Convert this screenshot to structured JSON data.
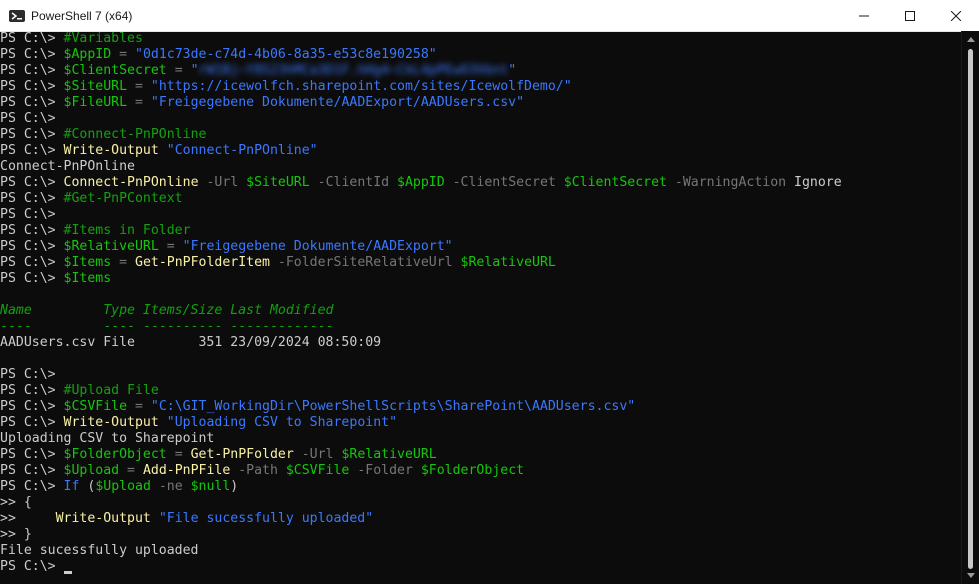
{
  "window": {
    "title": "PowerShell 7 (x64)",
    "minimize_label": "minimize",
    "maximize_label": "maximize",
    "close_label": "close"
  },
  "colors": {
    "default": "#cccccc",
    "comment": "#13a10e",
    "variable": "#16c60c",
    "string": "#3b78ff",
    "command": "#f9f1a5",
    "param": "#767676",
    "header": "#13a10e",
    "operator": "#767676",
    "keyword": "#3b78ff",
    "brace": "#cccccc"
  },
  "lines": [
    [
      {
        "t": "PS C:\\> ",
        "c": "default"
      },
      {
        "t": "#Variables",
        "c": "comment"
      }
    ],
    [
      {
        "t": "PS C:\\> ",
        "c": "default"
      },
      {
        "t": "$AppID",
        "c": "variable"
      },
      {
        "t": " = ",
        "c": "operator"
      },
      {
        "t": "\"0d1c73de-c74d-4b06-8a35-e53c8e190258\"",
        "c": "string"
      }
    ],
    [
      {
        "t": "PS C:\\> ",
        "c": "default"
      },
      {
        "t": "$ClientSecret",
        "c": "variable"
      },
      {
        "t": " = ",
        "c": "operator"
      },
      {
        "t": "\"",
        "c": "string"
      },
      {
        "t": "rW1Bj~Y8S23hMCa3D1F.hHg4~CkL4pPEwO3Vbnt",
        "c": "string",
        "blur": true
      },
      {
        "t": "\"",
        "c": "string"
      }
    ],
    [
      {
        "t": "PS C:\\> ",
        "c": "default"
      },
      {
        "t": "$SiteURL",
        "c": "variable"
      },
      {
        "t": " = ",
        "c": "operator"
      },
      {
        "t": "\"https://icewolfch.sharepoint.com/sites/IcewolfDemo/\"",
        "c": "string"
      }
    ],
    [
      {
        "t": "PS C:\\> ",
        "c": "default"
      },
      {
        "t": "$FileURL",
        "c": "variable"
      },
      {
        "t": " = ",
        "c": "operator"
      },
      {
        "t": "\"Freigegebene Dokumente/AADExport/AADUsers.csv\"",
        "c": "string"
      }
    ],
    [
      {
        "t": "PS C:\\>",
        "c": "default"
      }
    ],
    [
      {
        "t": "PS C:\\> ",
        "c": "default"
      },
      {
        "t": "#Connect-PnPOnline",
        "c": "comment"
      }
    ],
    [
      {
        "t": "PS C:\\> ",
        "c": "default"
      },
      {
        "t": "Write-Output",
        "c": "command"
      },
      {
        "t": " ",
        "c": "default"
      },
      {
        "t": "\"Connect-PnPOnline\"",
        "c": "string"
      }
    ],
    [
      {
        "t": "Connect-PnPOnline",
        "c": "default"
      }
    ],
    [
      {
        "t": "PS C:\\> ",
        "c": "default"
      },
      {
        "t": "Connect-PnPOnline",
        "c": "command"
      },
      {
        "t": " -Url ",
        "c": "param"
      },
      {
        "t": "$SiteURL",
        "c": "variable"
      },
      {
        "t": " -ClientId ",
        "c": "param"
      },
      {
        "t": "$AppID",
        "c": "variable"
      },
      {
        "t": " -ClientSecret ",
        "c": "param"
      },
      {
        "t": "$ClientSecret",
        "c": "variable"
      },
      {
        "t": " -WarningAction ",
        "c": "param"
      },
      {
        "t": "Ignore",
        "c": "default"
      }
    ],
    [
      {
        "t": "PS C:\\> ",
        "c": "default"
      },
      {
        "t": "#Get-PnPContext",
        "c": "comment"
      }
    ],
    [
      {
        "t": "PS C:\\>",
        "c": "default"
      }
    ],
    [
      {
        "t": "PS C:\\> ",
        "c": "default"
      },
      {
        "t": "#Items in Folder",
        "c": "comment"
      }
    ],
    [
      {
        "t": "PS C:\\> ",
        "c": "default"
      },
      {
        "t": "$RelativeURL",
        "c": "variable"
      },
      {
        "t": " = ",
        "c": "operator"
      },
      {
        "t": "\"Freigegebene Dokumente/AADExport\"",
        "c": "string"
      }
    ],
    [
      {
        "t": "PS C:\\> ",
        "c": "default"
      },
      {
        "t": "$Items",
        "c": "variable"
      },
      {
        "t": " = ",
        "c": "operator"
      },
      {
        "t": "Get-PnPFolderItem",
        "c": "command"
      },
      {
        "t": " -FolderSiteRelativeUrl ",
        "c": "param"
      },
      {
        "t": "$RelativeURL",
        "c": "variable"
      }
    ],
    [
      {
        "t": "PS C:\\> ",
        "c": "default"
      },
      {
        "t": "$Items",
        "c": "variable"
      }
    ],
    [
      {
        "t": "",
        "c": "default"
      }
    ],
    [
      {
        "t": "Name         Type Items/Size Last Modified",
        "c": "header",
        "italic": true
      }
    ],
    [
      {
        "t": "----         ---- ---------- -------------",
        "c": "header"
      }
    ],
    [
      {
        "t": "AADUsers.csv File        351 23/09/2024 08:50:09",
        "c": "default"
      }
    ],
    [
      {
        "t": "",
        "c": "default"
      }
    ],
    [
      {
        "t": "PS C:\\>",
        "c": "default"
      }
    ],
    [
      {
        "t": "PS C:\\> ",
        "c": "default"
      },
      {
        "t": "#Upload File",
        "c": "comment"
      }
    ],
    [
      {
        "t": "PS C:\\> ",
        "c": "default"
      },
      {
        "t": "$CSVFile",
        "c": "variable"
      },
      {
        "t": " = ",
        "c": "operator"
      },
      {
        "t": "\"C:\\GIT_WorkingDir\\PowerShellScripts\\SharePoint\\AADUsers.csv\"",
        "c": "string"
      }
    ],
    [
      {
        "t": "PS C:\\> ",
        "c": "default"
      },
      {
        "t": "Write-Output",
        "c": "command"
      },
      {
        "t": " ",
        "c": "default"
      },
      {
        "t": "\"Uploading CSV to Sharepoint\"",
        "c": "string"
      }
    ],
    [
      {
        "t": "Uploading CSV to Sharepoint",
        "c": "default"
      }
    ],
    [
      {
        "t": "PS C:\\> ",
        "c": "default"
      },
      {
        "t": "$FolderObject",
        "c": "variable"
      },
      {
        "t": " = ",
        "c": "operator"
      },
      {
        "t": "Get-PnPFolder",
        "c": "command"
      },
      {
        "t": " -Url ",
        "c": "param"
      },
      {
        "t": "$RelativeURL",
        "c": "variable"
      }
    ],
    [
      {
        "t": "PS C:\\> ",
        "c": "default"
      },
      {
        "t": "$Upload",
        "c": "variable"
      },
      {
        "t": " = ",
        "c": "operator"
      },
      {
        "t": "Add-PnPFile",
        "c": "command"
      },
      {
        "t": " -Path ",
        "c": "param"
      },
      {
        "t": "$CSVFile",
        "c": "variable"
      },
      {
        "t": " -Folder ",
        "c": "param"
      },
      {
        "t": "$FolderObject",
        "c": "variable"
      }
    ],
    [
      {
        "t": "PS C:\\> ",
        "c": "default"
      },
      {
        "t": "If",
        "c": "keyword"
      },
      {
        "t": " (",
        "c": "default"
      },
      {
        "t": "$Upload",
        "c": "variable"
      },
      {
        "t": " -ne ",
        "c": "param"
      },
      {
        "t": "$null",
        "c": "variable"
      },
      {
        "t": ")",
        "c": "default"
      }
    ],
    [
      {
        "t": ">> {",
        "c": "default"
      }
    ],
    [
      {
        "t": ">>     ",
        "c": "default"
      },
      {
        "t": "Write-Output",
        "c": "command"
      },
      {
        "t": " ",
        "c": "default"
      },
      {
        "t": "\"File sucessfully uploaded\"",
        "c": "string"
      }
    ],
    [
      {
        "t": ">> }",
        "c": "default"
      }
    ],
    [
      {
        "t": "File sucessfully uploaded",
        "c": "default"
      }
    ],
    [
      {
        "t": "PS C:\\> ",
        "c": "default"
      },
      {
        "t": "",
        "c": "default",
        "cursor": true
      }
    ]
  ]
}
